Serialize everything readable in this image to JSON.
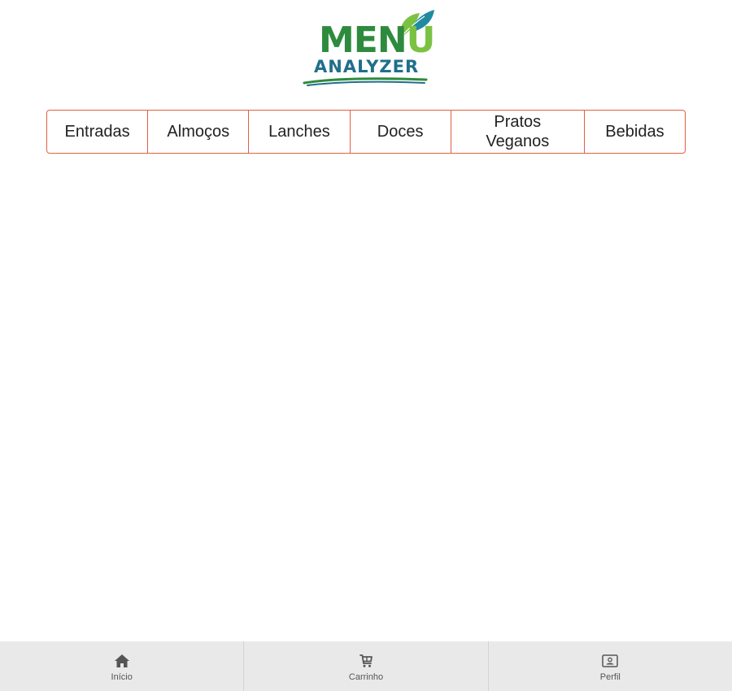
{
  "logo": {
    "line1_main": "MEN",
    "line1_accent": "U",
    "line2": "ANALYZER"
  },
  "categories": [
    {
      "label": "Entradas"
    },
    {
      "label": "Almoços"
    },
    {
      "label": "Lanches"
    },
    {
      "label": "Doces"
    },
    {
      "label": "Pratos Veganos"
    },
    {
      "label": "Bebidas"
    }
  ],
  "bottom_nav": [
    {
      "label": "Início",
      "icon": "home-icon"
    },
    {
      "label": "Carrinho",
      "icon": "cart-icon"
    },
    {
      "label": "Perfil",
      "icon": "profile-icon"
    }
  ],
  "colors": {
    "tab_border": "#e0603f",
    "logo_green": "#2e8b3d",
    "logo_light_green": "#7cc242",
    "logo_blue": "#1f6f8b",
    "nav_background": "#e9e9e9"
  }
}
